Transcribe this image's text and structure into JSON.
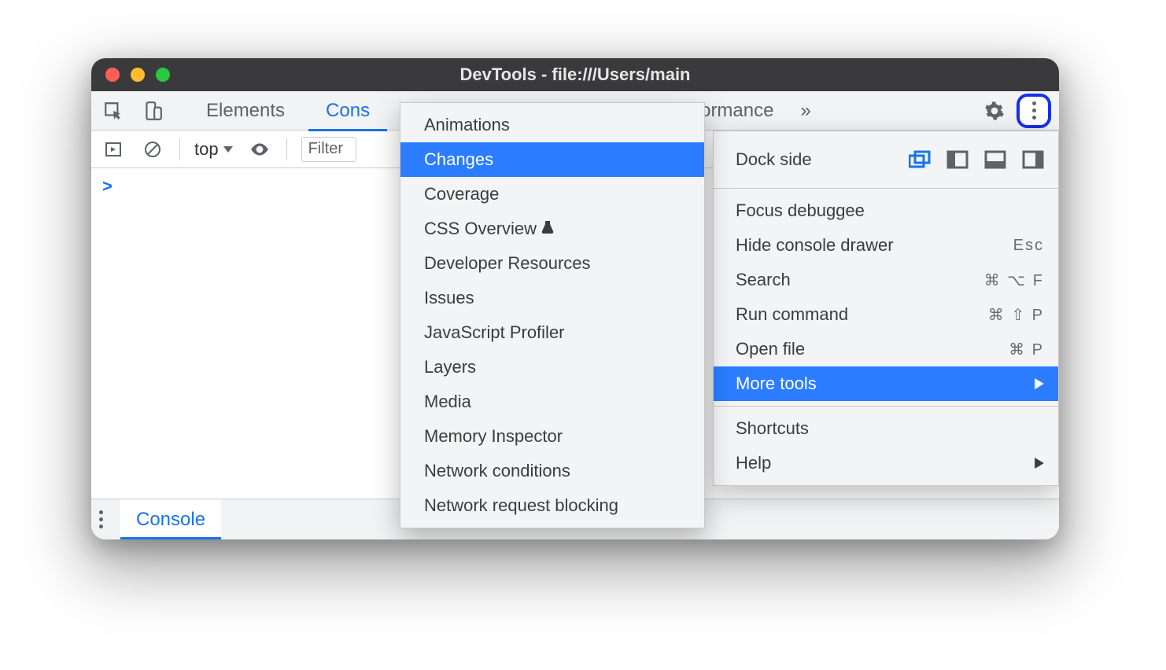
{
  "window": {
    "title": "DevTools - file:///Users/main"
  },
  "tabs": {
    "elements": "Elements",
    "console_truncated": "Cons",
    "performance_truncated": "Performance"
  },
  "subtoolbar": {
    "context": "top",
    "filter_placeholder": "Filter"
  },
  "console": {
    "prompt": ">"
  },
  "drawer": {
    "tab": "Console"
  },
  "menu": {
    "dock_side": "Dock side",
    "focus_debuggee": "Focus debuggee",
    "hide_console_drawer": "Hide console drawer",
    "hide_console_drawer_shortcut": "Esc",
    "search": "Search",
    "search_shortcut": "⌘ ⌥ F",
    "run_command": "Run command",
    "run_command_shortcut": "⌘ ⇧ P",
    "open_file": "Open file",
    "open_file_shortcut": "⌘ P",
    "more_tools": "More tools",
    "shortcuts": "Shortcuts",
    "help": "Help"
  },
  "submenu": {
    "animations": "Animations",
    "changes": "Changes",
    "coverage": "Coverage",
    "css_overview": "CSS Overview",
    "developer_resources": "Developer Resources",
    "issues": "Issues",
    "javascript_profiler": "JavaScript Profiler",
    "layers": "Layers",
    "media": "Media",
    "memory_inspector": "Memory Inspector",
    "network_conditions": "Network conditions",
    "network_request_blocking": "Network request blocking"
  }
}
